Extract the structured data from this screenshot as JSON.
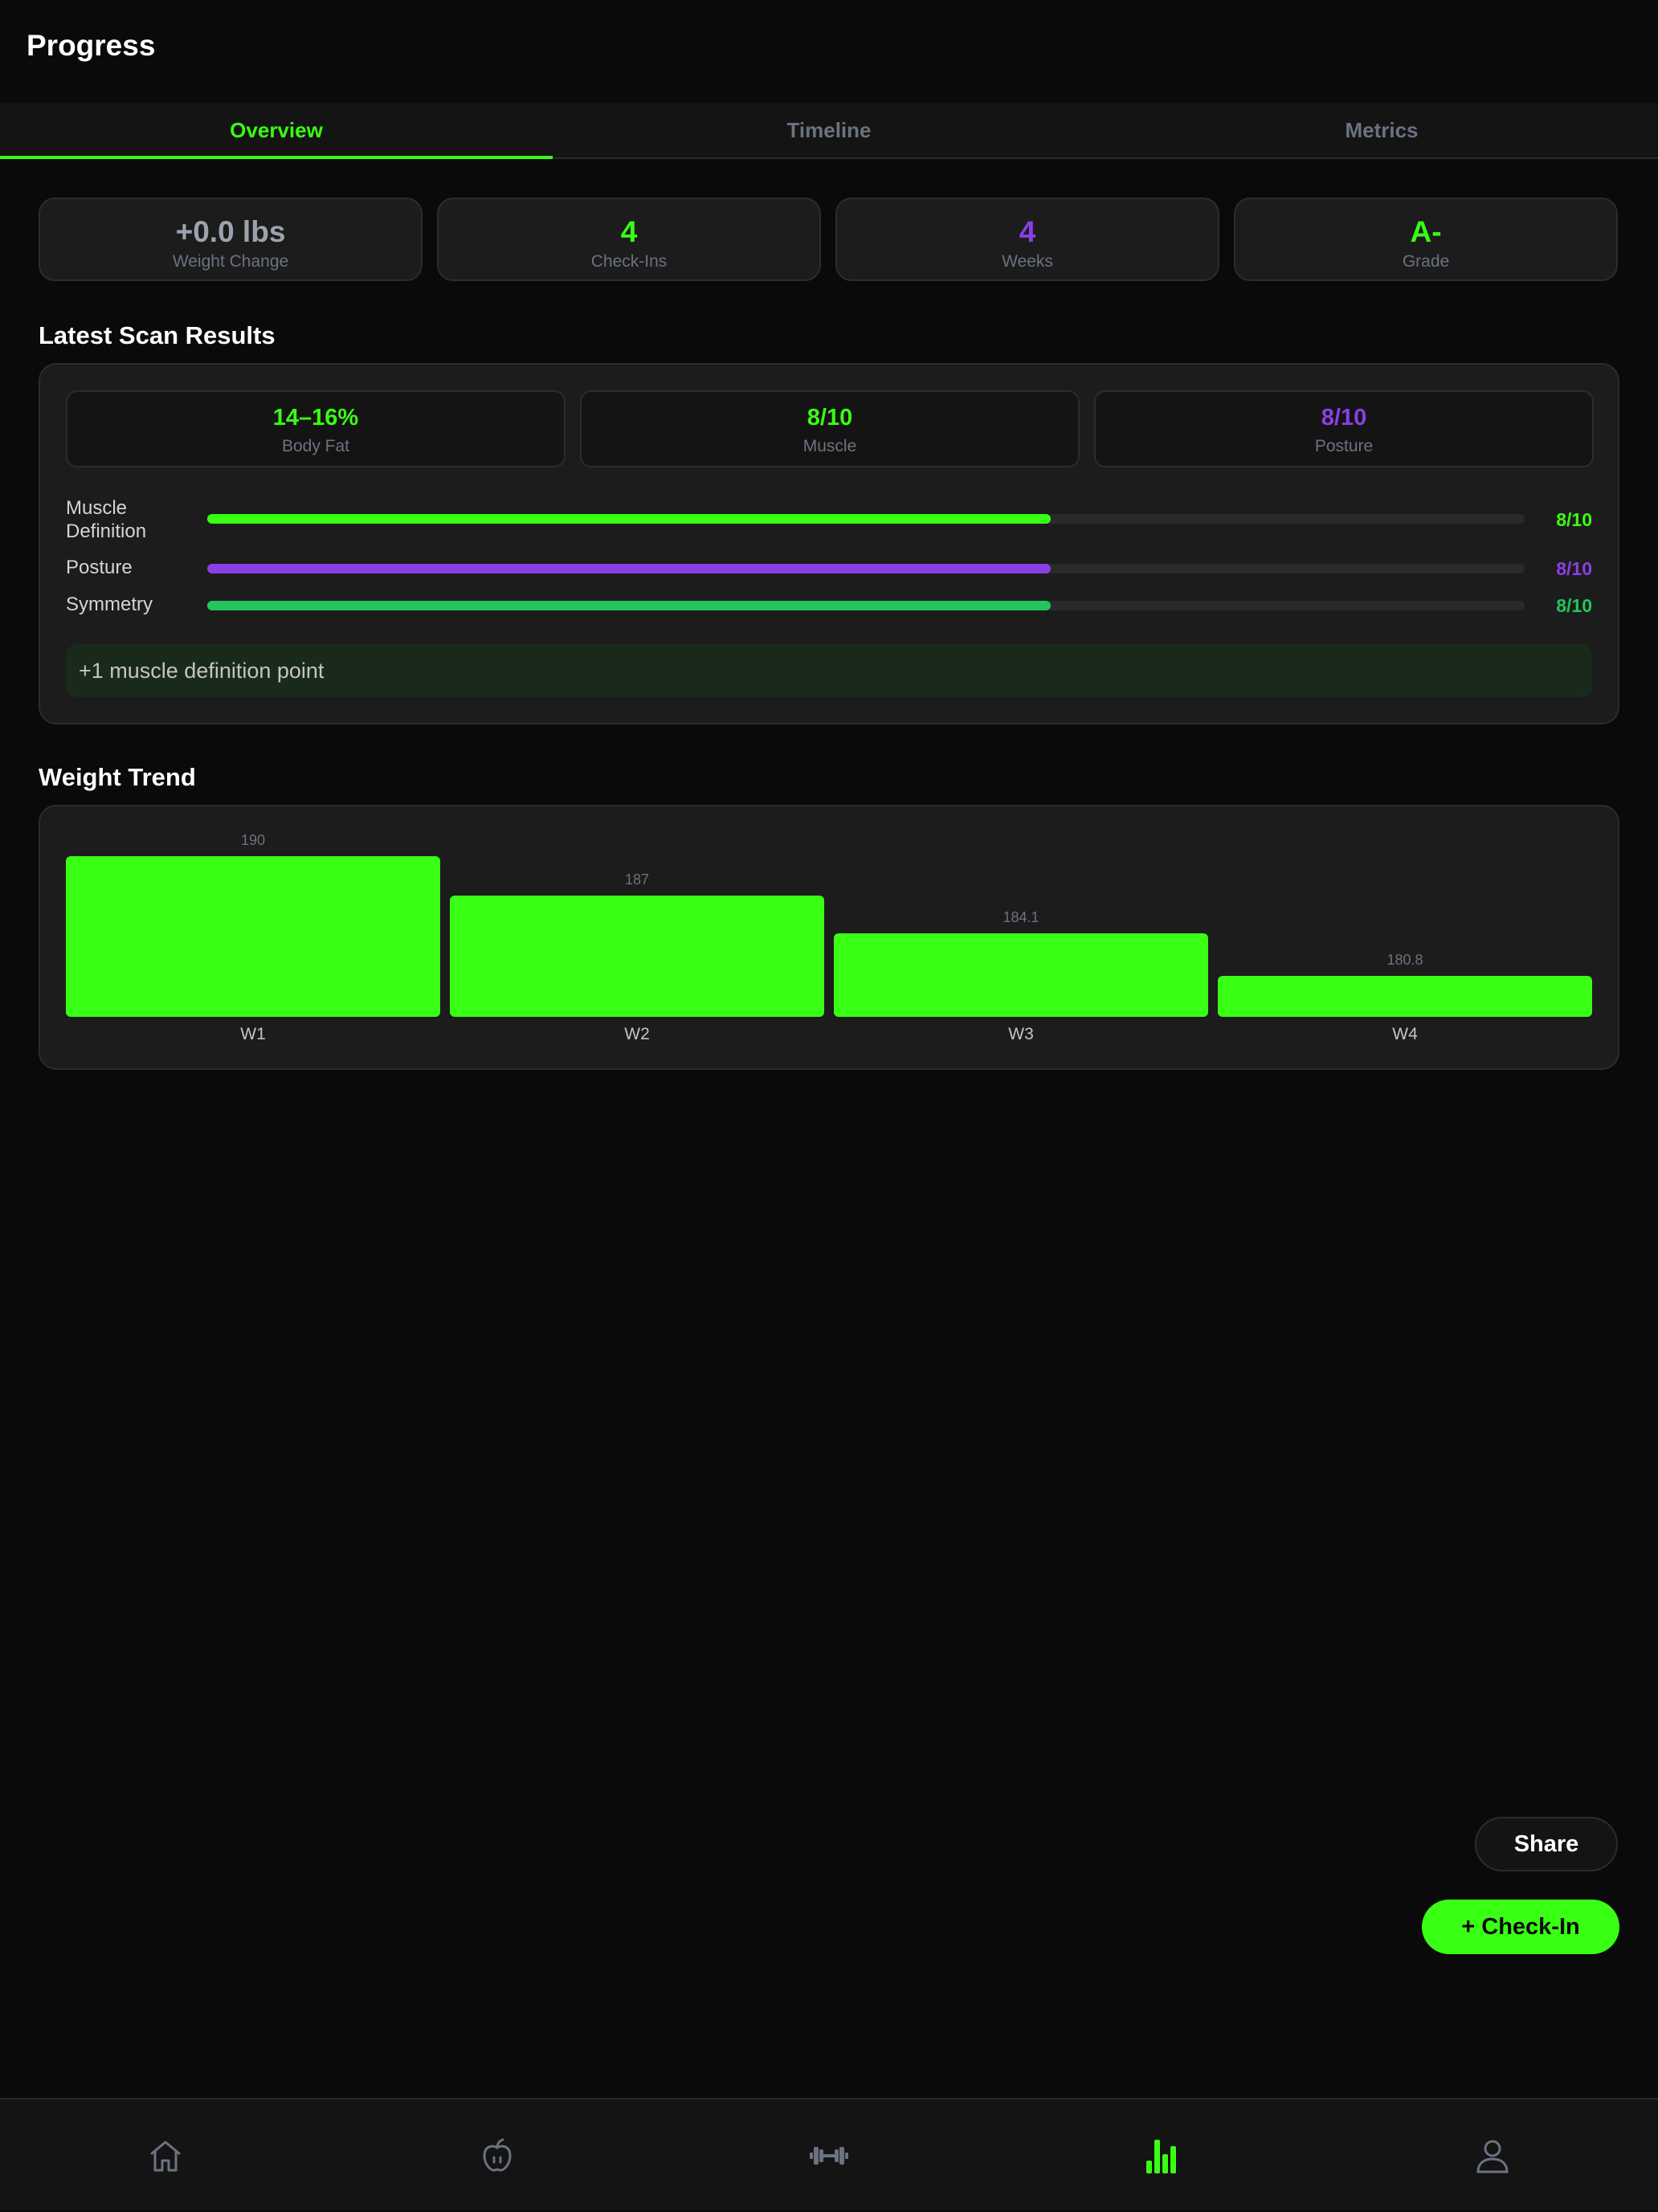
{
  "header": {
    "title": "Progress"
  },
  "tabs": [
    {
      "label": "Overview",
      "active": true
    },
    {
      "label": "Timeline",
      "active": false
    },
    {
      "label": "Metrics",
      "active": false
    }
  ],
  "stats": [
    {
      "value": "+0.0 lbs",
      "label": "Weight Change",
      "color": "#9ca3af"
    },
    {
      "value": "4",
      "label": "Check-Ins",
      "color": "#39ff14"
    },
    {
      "value": "4",
      "label": "Weeks",
      "color": "#8b3fe6"
    },
    {
      "value": "A-",
      "label": "Grade",
      "color": "#39ff14"
    }
  ],
  "scan": {
    "title": "Latest Scan Results",
    "cards": [
      {
        "value": "14–16%",
        "label": "Body Fat",
        "color": "#39ff14"
      },
      {
        "value": "8/10",
        "label": "Muscle",
        "color": "#39ff14"
      },
      {
        "value": "8/10",
        "label": "Posture",
        "color": "#8b3fe6"
      }
    ],
    "metrics": [
      {
        "label": "Muscle Definition",
        "value": "8/10",
        "score": 8,
        "max": 10,
        "color": "#39ff14"
      },
      {
        "label": "Posture",
        "value": "8/10",
        "score": 8,
        "max": 10,
        "color": "#8b3fe6"
      },
      {
        "label": "Symmetry",
        "value": "8/10",
        "score": 8,
        "max": 10,
        "color": "#22c55e"
      }
    ],
    "note": "+1 muscle definition point"
  },
  "weight_trend": {
    "title": "Weight Trend"
  },
  "chart_data": {
    "type": "bar",
    "categories": [
      "W1",
      "W2",
      "W3",
      "W4"
    ],
    "values": [
      190,
      187,
      184.1,
      180.8
    ],
    "value_labels": [
      "190",
      "187",
      "184.1",
      "180.8"
    ],
    "color": "#39ff14"
  },
  "actions": {
    "share_label": "Share",
    "checkin_label": "+ Check-In"
  },
  "bottom_nav": [
    {
      "icon": "home-icon",
      "active": false
    },
    {
      "icon": "apple-icon",
      "active": false
    },
    {
      "icon": "dumbbell-icon",
      "active": false
    },
    {
      "icon": "bar-chart-icon",
      "active": true
    },
    {
      "icon": "user-icon",
      "active": false
    }
  ],
  "colors": {
    "accent": "#39ff14",
    "purple": "#8b3fe6",
    "muted": "#6b7280",
    "background": "#0a0a0a"
  }
}
